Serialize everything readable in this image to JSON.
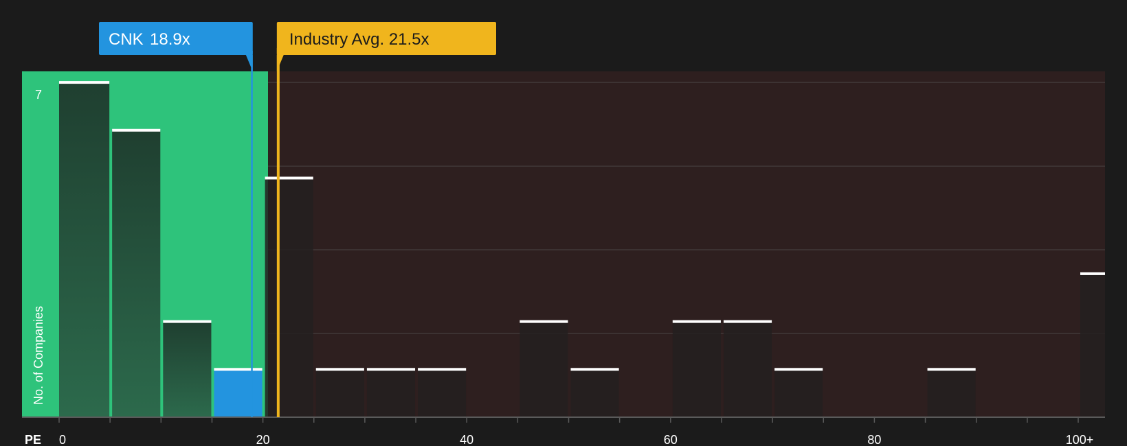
{
  "chart_data": {
    "type": "bar",
    "xlabel": "PE",
    "ylabel": "No. of Companies",
    "x_tick_labels": [
      "0",
      "20",
      "40",
      "60",
      "80",
      "100+"
    ],
    "y_tick_labels": [
      "7"
    ],
    "bin_width": 5,
    "xlim": [
      0,
      103
    ],
    "ylim": [
      0,
      7
    ],
    "grid": true,
    "bins": [
      {
        "start": 0,
        "end": 5,
        "value": 7
      },
      {
        "start": 5,
        "end": 10,
        "value": 6
      },
      {
        "start": 10,
        "end": 15,
        "value": 2
      },
      {
        "start": 15,
        "end": 20,
        "value": 1,
        "highlight": true
      },
      {
        "start": 20,
        "end": 25,
        "value": 5
      },
      {
        "start": 25,
        "end": 30,
        "value": 1
      },
      {
        "start": 30,
        "end": 35,
        "value": 1
      },
      {
        "start": 35,
        "end": 40,
        "value": 1
      },
      {
        "start": 45,
        "end": 50,
        "value": 2
      },
      {
        "start": 50,
        "end": 55,
        "value": 1
      },
      {
        "start": 60,
        "end": 65,
        "value": 2
      },
      {
        "start": 65,
        "end": 70,
        "value": 2
      },
      {
        "start": 70,
        "end": 75,
        "value": 1
      },
      {
        "start": 85,
        "end": 90,
        "value": 1
      },
      {
        "start": 100,
        "end": 103,
        "value": 3
      }
    ],
    "company": {
      "ticker": "CNK",
      "value": 18.9,
      "label": "CNK",
      "value_label": "18.9x",
      "color": "#2394df"
    },
    "industry_avg": {
      "value": 21.5,
      "label": "Industry Avg. 21.5x",
      "color": "#f0b51d"
    },
    "fair_zone_end": 20.5,
    "colors": {
      "fair_zone": "#2ec37b",
      "over_zone": "#2e1f1f",
      "bar_in_fair": "#244a37",
      "bar_over": "#232020",
      "bar_top": "#ffffff",
      "grid": "#4a4444"
    }
  }
}
